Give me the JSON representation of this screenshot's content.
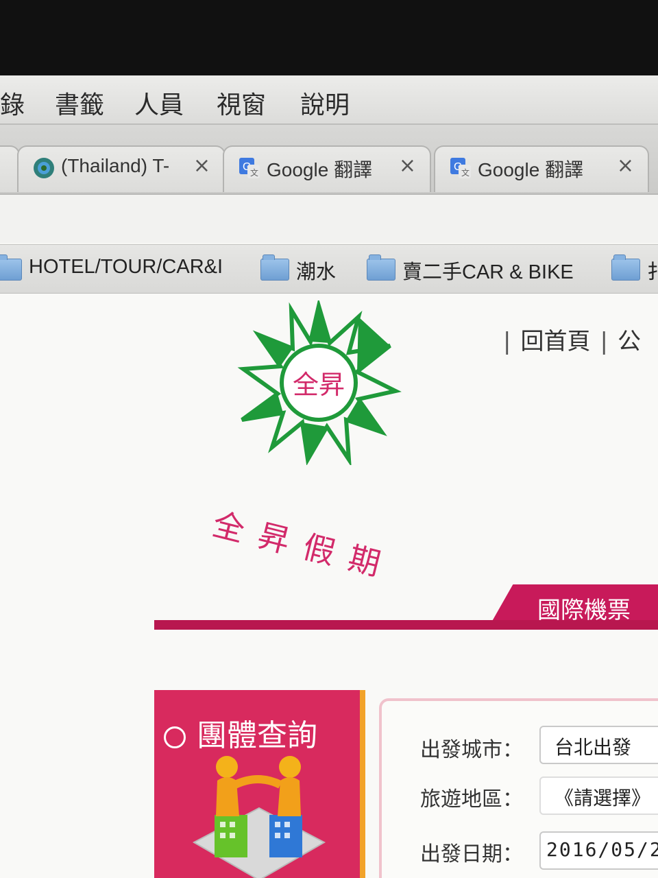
{
  "menubar": {
    "items": [
      "錄",
      "書籤",
      "人員",
      "視窗",
      "說明"
    ]
  },
  "tabs": [
    {
      "title": "(Thailand) T-",
      "icon": "tripadvisor-icon",
      "close": "×"
    },
    {
      "title": "Google 翻譯",
      "icon": "google-translate-icon",
      "close": "×"
    },
    {
      "title": "Google 翻譯",
      "icon": "google-translate-icon",
      "close": "×"
    }
  ],
  "bookmarks": [
    {
      "label": "HOTEL/TOUR/CAR&I",
      "icon": "folder-icon"
    },
    {
      "label": "潮水",
      "icon": "folder-icon"
    },
    {
      "label": "賣二手CAR & BIKE",
      "icon": "folder-icon"
    },
    {
      "label": "扌",
      "icon": "folder-icon"
    }
  ],
  "site": {
    "logo_center_text": "全昇",
    "logo_text": "全昇假期",
    "top_links": [
      "回首頁",
      "公"
    ],
    "flight_tab": "國際機票",
    "group_search_title": "團體查詢",
    "form": {
      "departure_city_label": "出發城市：",
      "departure_city_value": "台北出發",
      "region_label": "旅遊地區：",
      "region_value": "《請選擇》",
      "date_label": "出發日期：",
      "date_value": "2016/05/2"
    }
  },
  "colors": {
    "brand_green": "#1f9a3a",
    "brand_pink": "#d82a5e",
    "accent_red": "#b8174f"
  }
}
